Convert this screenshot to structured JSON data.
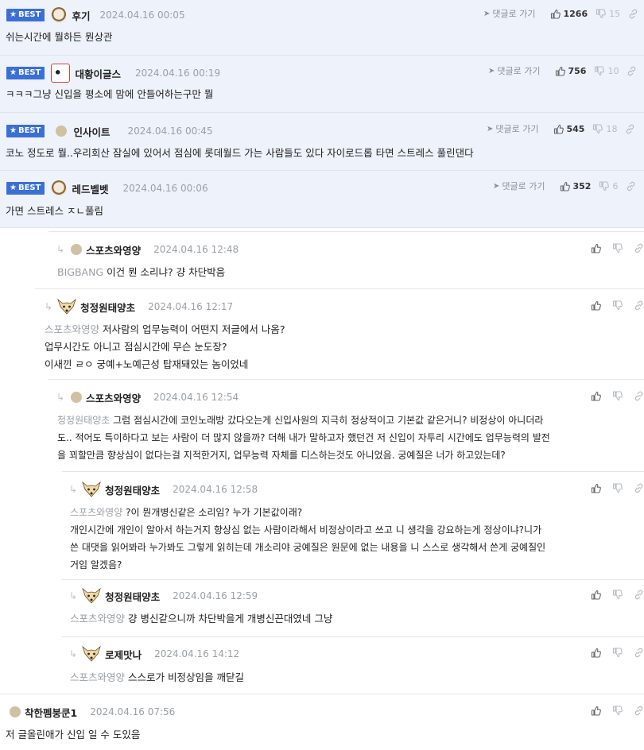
{
  "labels": {
    "best": "BEST",
    "goto": "댓글로 가기"
  },
  "colors": {
    "best_bg": "#eef2fa",
    "badge": "#3b6fd8",
    "mention": "#9aa0a6"
  },
  "best_comments": [
    {
      "nick": "후기",
      "date": "2024.04.16 00:05",
      "up": "1266",
      "down": "15",
      "text": "쉬는시간에 뭘하든 뭔상관",
      "avatar": "dog-icon"
    },
    {
      "nick": "대황이글스",
      "date": "2024.04.16 00:19",
      "up": "756",
      "down": "10",
      "text": "ㅋㅋㅋ그냥 신입을 평소에 맘에 안들어하는구만 뭘",
      "avatar": "panda-icon"
    },
    {
      "nick": "인사이트",
      "date": "2024.04.16 00:45",
      "up": "545",
      "down": "18",
      "text": "코노 정도로 뭘..우리회산 잠실에 있어서 점심에 롯데월드 가는 사람들도 있다 자이로드롭 타면 스트레스 풀린댄다",
      "avatar": "dot-icon"
    },
    {
      "nick": "레드벨벳",
      "date": "2024.04.16 00:06",
      "up": "352",
      "down": "6",
      "text": "가면 스트레스 ㅈㄴ풀림",
      "avatar": "dog-icon"
    }
  ],
  "comments": [
    {
      "nick": "스포츠와영양",
      "date": "2024.04.16 12:48",
      "mention": "BIGBANG",
      "lines": [
        "이건 뭔 소리냐? 걍 차단박음"
      ]
    },
    {
      "nick": "청정원태양초",
      "date": "2024.04.16 12:17",
      "mention": "스포츠와영양",
      "lines": [
        "저사람의 업무능력이 어떤지 저글에서 나옴?",
        "업무시간도 아니고 점심시간에 무슨 눈도장?",
        "이새낀 ㄹㅇ 궁예+노예근성 탑재돼있는 놈이었네"
      ]
    },
    {
      "nick": "스포츠와영양",
      "date": "2024.04.16 12:54",
      "mention": "청정원태양초",
      "lines": [
        "그럼 점심시간에 코인노래방 갔다오는게 신입사원의 지극히 정상적이고 기본값 같은거니? 비정상이 아니더라",
        "도.. 적어도 특이하다고 보는 사람이 더 많지 않을까? 더해 내가 말하고자 했던건 저 신입이 자투리 시간에도 업무능력의 발전",
        "을 꾀할만큼 향상심이 없다는걸 지적한거지, 업무능력 자체를 디스하는것도 아니었음. 궁예질은 너가 하고있는데?"
      ]
    },
    {
      "nick": "청정원태양초",
      "date": "2024.04.16 12:58",
      "mention": "스포츠와영양",
      "lines": [
        "?이 뭔개병신같은 소리임? 누가 기본값이래?",
        "개인시간에 개인이 알아서 하는거지 향상심 없는 사람이라해서 비정상이라고 쓰고 니 생각을 강요하는게 정상이냐?니가",
        "쓴 대댓을 읽어봐라 누가봐도 그렇게 읽히는데 개소리야 궁예질은 원문에 없는 내용을 니 스스로 생각해서 쓴게 궁예질인",
        "거임 알겠음?"
      ]
    },
    {
      "nick": "청정원태양초",
      "date": "2024.04.16 12:59",
      "mention": "스포츠와영양",
      "lines": [
        "걍 병신같으니까 차단박을게 개병신끈대였네 그냥"
      ]
    },
    {
      "nick": "로제맛나",
      "date": "2024.04.16 14:12",
      "mention": "스포츠와영양",
      "lines": [
        "스스로가 비정상임을 깨닫길"
      ]
    },
    {
      "nick": "착한펨붕쿤1",
      "date": "2024.04.16 07:56",
      "mention": "",
      "lines": [
        "저 글올린애가 신입 일 수 도있음"
      ]
    }
  ]
}
